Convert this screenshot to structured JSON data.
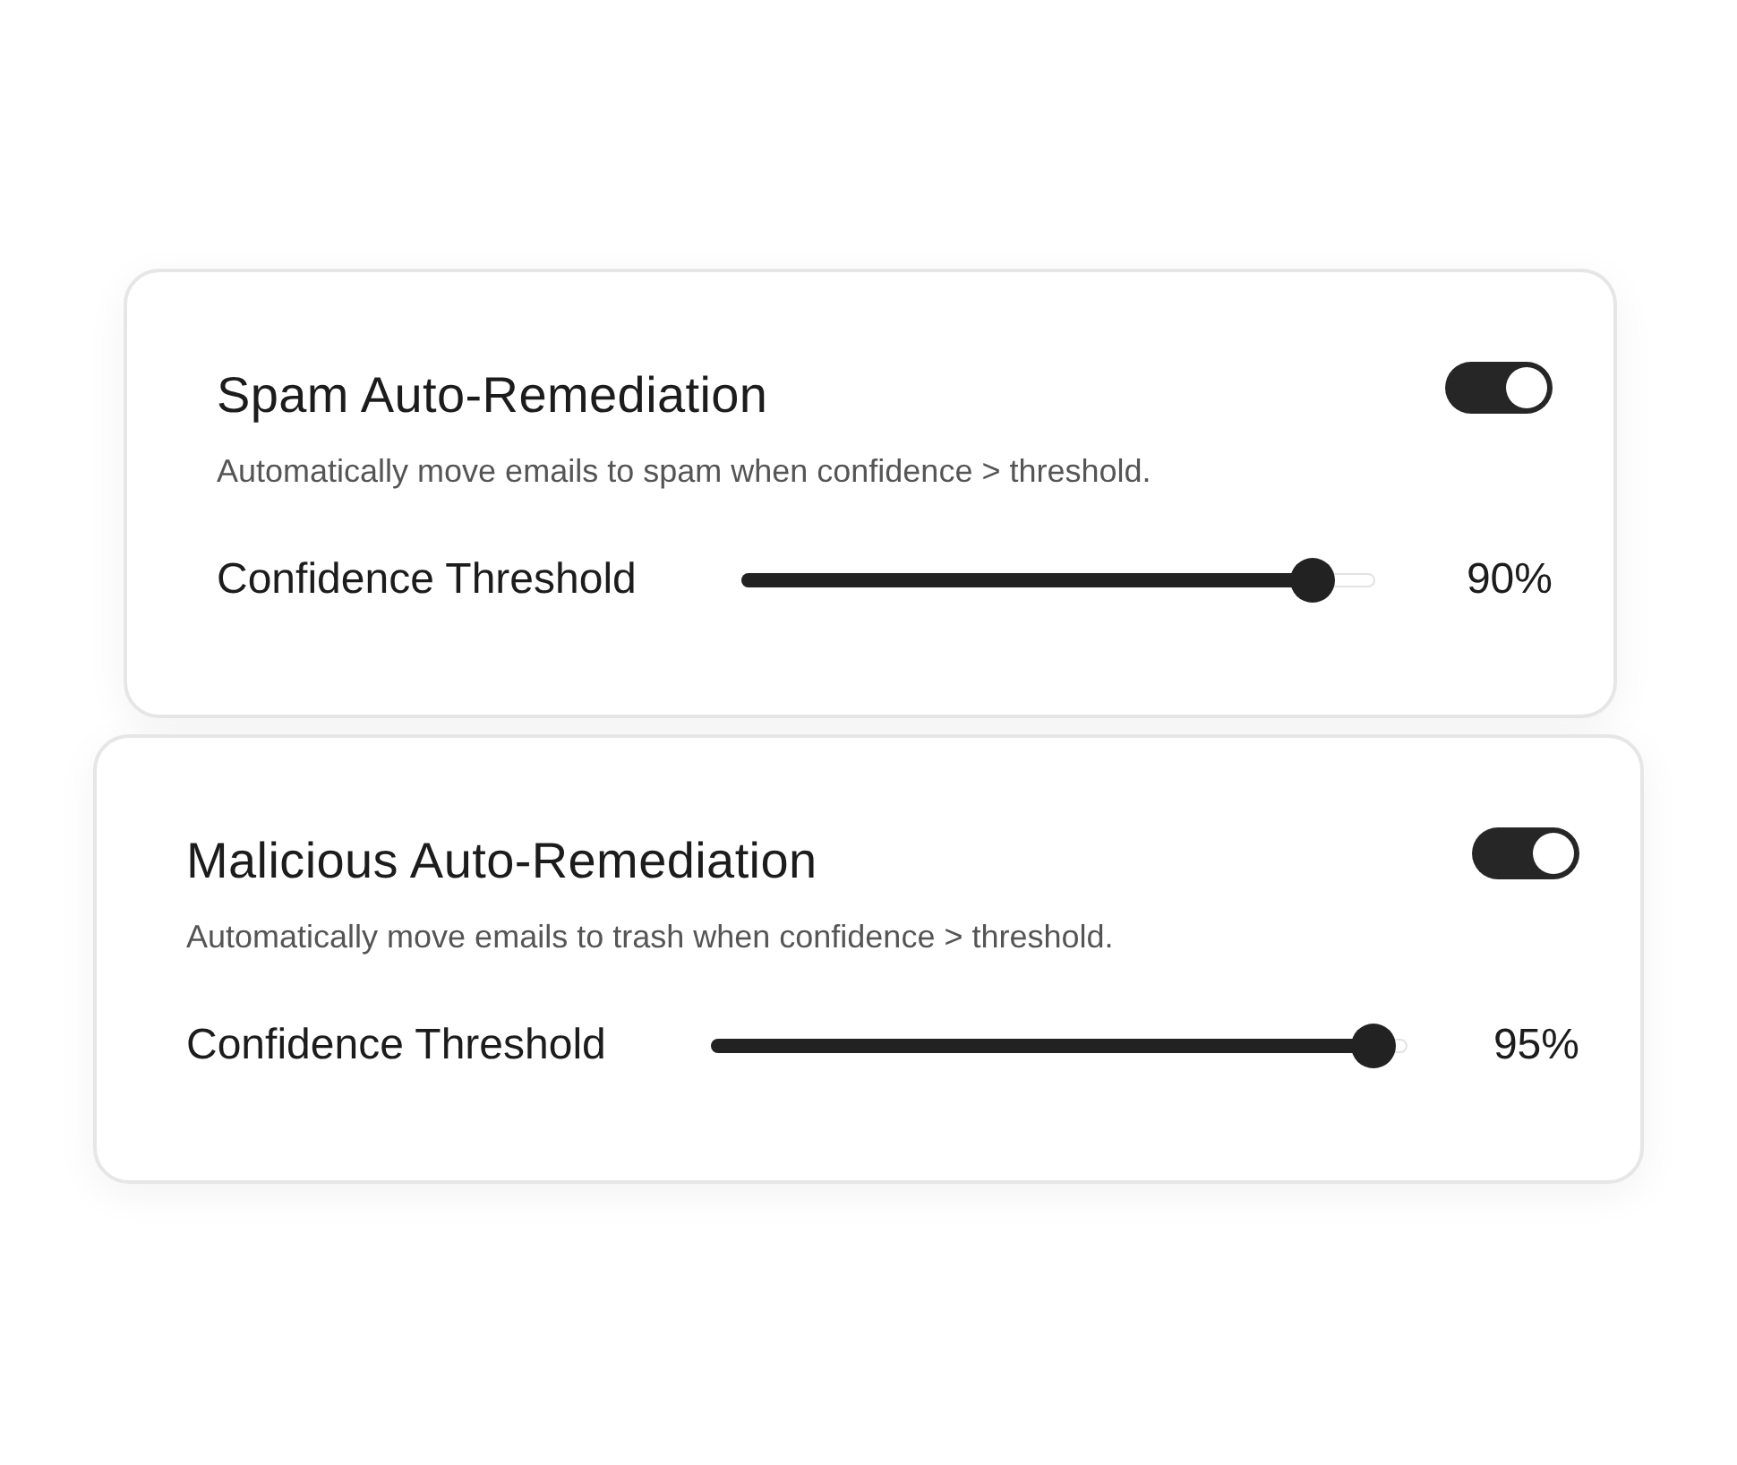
{
  "cards": [
    {
      "title": "Spam Auto-Remediation",
      "enabled": true,
      "description": "Automatically move emails to spam when confidence > threshold.",
      "slider_label": "Confidence Threshold",
      "level": 0.9,
      "reading": "90%"
    },
    {
      "title": "Malicious Auto-Remediation",
      "enabled": true,
      "description": "Automatically move emails to trash when confidence > threshold.",
      "slider_label": "Confidence Threshold",
      "level": 0.95,
      "reading": "95%"
    }
  ]
}
